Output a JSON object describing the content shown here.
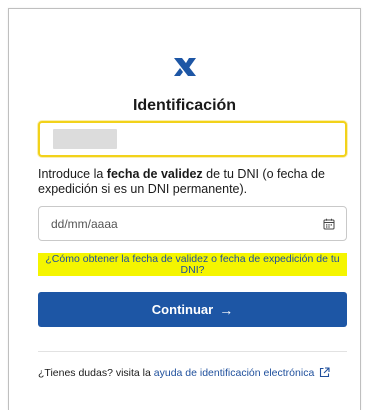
{
  "header": {
    "logo_icon": "agency-logo-icon",
    "title": "Identificación"
  },
  "id_field": {
    "value": "",
    "redacted": true,
    "border_color": "#f2d21a"
  },
  "instructions": {
    "before": "Introduce la ",
    "bold": "fecha de validez",
    "after": " de tu DNI (o fecha de expedición si es un DNI permanente)."
  },
  "date_field": {
    "placeholder": "dd/mm/aaaa",
    "icon": "calendar-icon"
  },
  "help_link": {
    "label": "¿Cómo obtener la fecha de validez o fecha de expedición de tu DNI?",
    "highlight_color": "#f5f500"
  },
  "continue_button": {
    "label": "Continuar",
    "arrow": "→",
    "color": "#1d56a5"
  },
  "footer": {
    "text": "¿Tienes dudas? visita la ",
    "link_label": "ayuda de identificación electrónica",
    "icon": "external-link-icon"
  },
  "colors": {
    "link": "#1e4f9c"
  }
}
